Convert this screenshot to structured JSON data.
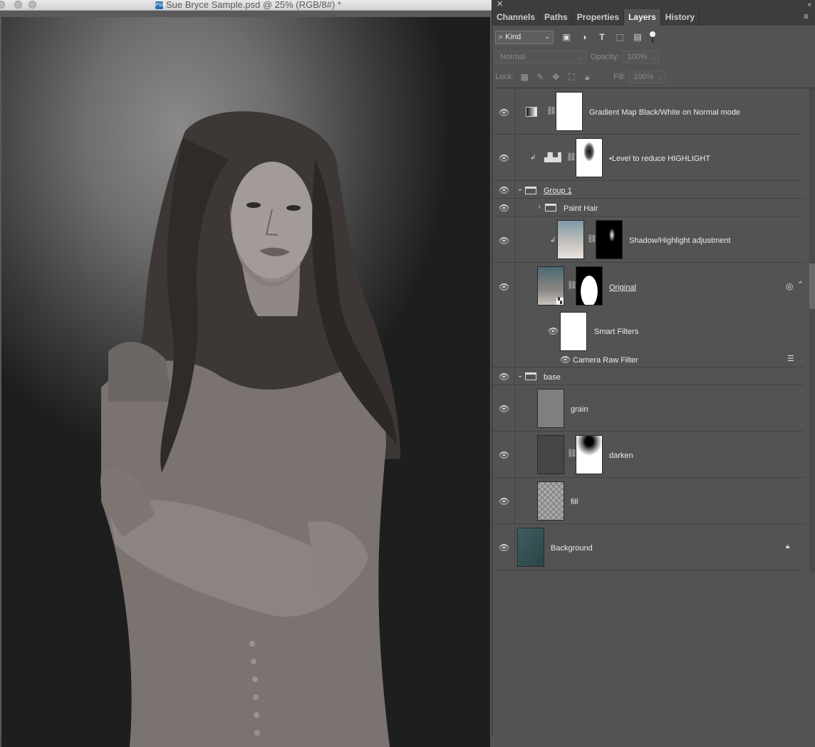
{
  "document": {
    "title": "Sue Bryce Sample.psd @ 25% (RGB/8#) *",
    "file_icon": "PSD"
  },
  "panel": {
    "tabs": [
      {
        "label": "Channels",
        "active": false
      },
      {
        "label": "Paths",
        "active": false
      },
      {
        "label": "Properties",
        "active": false
      },
      {
        "label": "Layers",
        "active": true
      },
      {
        "label": "History",
        "active": false
      }
    ],
    "filter": {
      "kind_label": "Kind",
      "icons": [
        "image-filter-icon",
        "adjustment-filter-icon",
        "type-filter-icon",
        "shape-filter-icon",
        "smart-object-filter-icon"
      ]
    },
    "blend_mode": "Normal",
    "opacity_label": "Opacity:",
    "opacity_value": "100%",
    "lock_label": "Lock:",
    "fill_label": "Fill:",
    "fill_value": "100%"
  },
  "layers": [
    {
      "name": "Gradient Map  Black/White on Normal mode",
      "type": "adjustment",
      "visible": true
    },
    {
      "name": "•Level to reduce HIGHLIGHT",
      "type": "adjustment",
      "clipped": true,
      "visible": true
    },
    {
      "name": "Group 1",
      "type": "group",
      "expanded": true,
      "visible": true
    },
    {
      "name": "Paint Hair",
      "type": "group",
      "expanded": false,
      "visible": true
    },
    {
      "name": "Shadow/Highlight adjustment",
      "type": "smart-object",
      "clipped": true,
      "visible": true
    },
    {
      "name": "Original",
      "type": "smart-object",
      "visible": true
    },
    {
      "name": "Smart Filters",
      "type": "smart-filters",
      "visible": true
    },
    {
      "name": "Camera Raw Filter",
      "type": "filter",
      "visible": true
    },
    {
      "name": "base",
      "type": "group",
      "expanded": true,
      "visible": true
    },
    {
      "name": "grain",
      "type": "pixel",
      "visible": true
    },
    {
      "name": "darken",
      "type": "pixel",
      "visible": true
    },
    {
      "name": "fill",
      "type": "pixel",
      "visible": true
    },
    {
      "name": "Background",
      "type": "background",
      "locked": true,
      "visible": true
    }
  ],
  "colors": {
    "panel_bg": "#535353",
    "tab_bar": "#3d3d3d",
    "accent_text": "#ececec"
  }
}
